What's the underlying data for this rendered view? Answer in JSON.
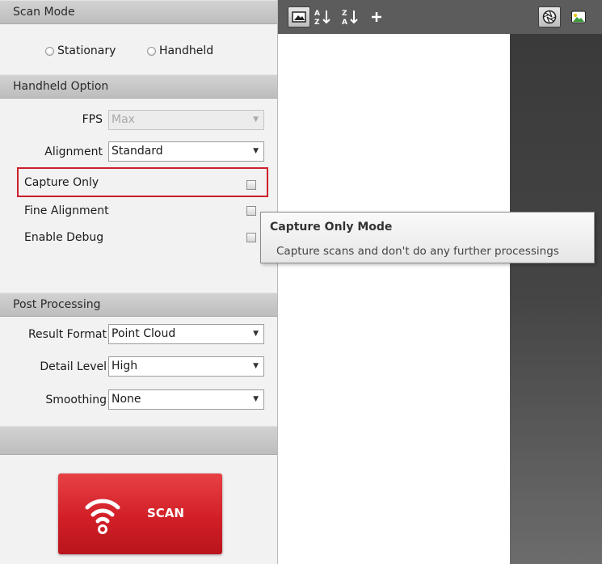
{
  "scan_mode": {
    "header": "Scan Mode",
    "options": [
      "Stationary",
      "Handheld"
    ]
  },
  "handheld_option": {
    "header": "Handheld Option",
    "fps": {
      "label": "FPS",
      "value": "Max"
    },
    "alignment": {
      "label": "Alignment",
      "value": "Standard"
    },
    "capture_only": {
      "label": "Capture Only",
      "checked": false
    },
    "fine_alignment": {
      "label": "Fine Alignment",
      "checked": false
    },
    "enable_debug": {
      "label": "Enable Debug",
      "checked": false
    }
  },
  "post_processing": {
    "header": "Post Processing",
    "result_format": {
      "label": "Result Format",
      "value": "Point Cloud"
    },
    "detail_level": {
      "label": "Detail Level",
      "value": "High"
    },
    "smoothing": {
      "label": "Smoothing",
      "value": "None"
    }
  },
  "scan_button": {
    "label": "SCAN",
    "color": "#d21f27",
    "icon": "wifi-icon"
  },
  "toolbar": {
    "icons": [
      "image-icon",
      "sort-a-z-icon",
      "sort-z-a-icon",
      "add-icon",
      "aperture-icon",
      "photo-landscape-icon"
    ]
  },
  "tooltip": {
    "title": "Capture Only Mode",
    "body": "Capture scans and don't do any further processings"
  },
  "colors": {
    "highlight": "#cc1f2a",
    "toolbar": "#5c5c5c"
  }
}
